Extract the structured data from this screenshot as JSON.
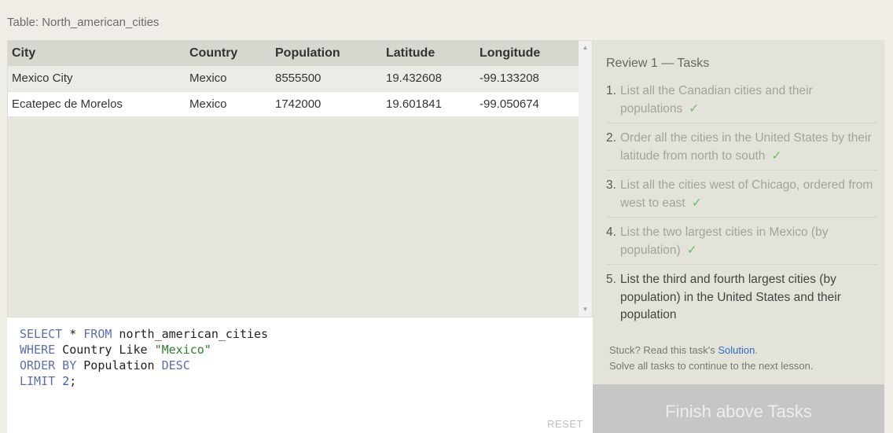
{
  "table_caption": "Table: North_american_cities",
  "results": {
    "columns": [
      "City",
      "Country",
      "Population",
      "Latitude",
      "Longitude"
    ],
    "rows": [
      [
        "Mexico City",
        "Mexico",
        "8555500",
        "19.432608",
        "-99.133208"
      ],
      [
        "Ecatepec de Morelos",
        "Mexico",
        "1742000",
        "19.601841",
        "-99.050674"
      ]
    ]
  },
  "editor": {
    "lines": [
      {
        "kw1": "SELECT",
        "mid": " * ",
        "kw2": "FROM",
        "rest": " north_american_cities"
      },
      {
        "kw1": "WHERE",
        "rest": " Country Like ",
        "str": "\"Mexico\""
      },
      {
        "kw1": "ORDER BY",
        "rest": " Population ",
        "kw2": "DESC"
      },
      {
        "kw1": "LIMIT",
        "rest": " ",
        "num": "2",
        "end": ";"
      }
    ],
    "reset_label": "RESET"
  },
  "tasks": {
    "title": "Review 1 — Tasks",
    "items": [
      {
        "num": "1.",
        "text": "List all the Canadian cities and their populations",
        "done": true
      },
      {
        "num": "2.",
        "text": "Order all the cities in the United States by their latitude from north to south",
        "done": true
      },
      {
        "num": "3.",
        "text": "List all the cities west of Chicago, ordered from west to east",
        "done": true
      },
      {
        "num": "4.",
        "text": "List the two largest cities in Mexico (by population)",
        "done": true
      },
      {
        "num": "5.",
        "text": "List the third and fourth largest cities (by population) in the United States and their population",
        "done": false
      }
    ],
    "check_glyph": "✓",
    "help_prefix": "Stuck? Read this task's ",
    "help_link": "Solution",
    "help_suffix": ".",
    "help_line2": "Solve all tasks to continue to the next lesson.",
    "finish_label": "Finish above Tasks"
  },
  "colors": {
    "keyword": "#5a6fb0",
    "string": "#2f7d2f",
    "check": "#6bbf6b",
    "link": "#2d6cc8"
  }
}
